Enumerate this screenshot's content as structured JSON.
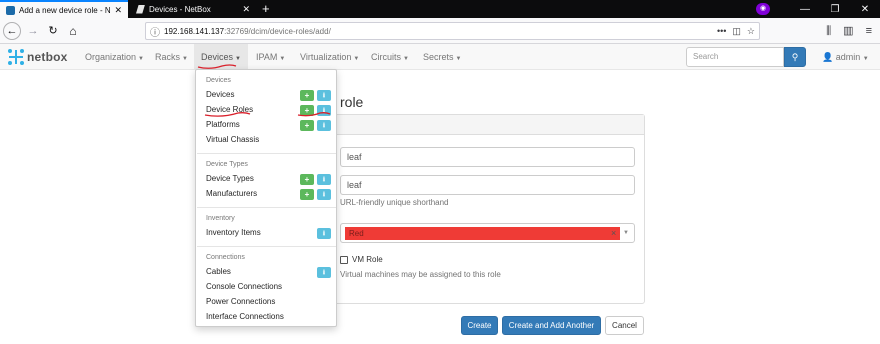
{
  "browser": {
    "tabs": [
      {
        "title": "Add a new device role - NetBo",
        "active": true
      },
      {
        "title": "Devices - NetBox",
        "active": false
      }
    ],
    "url_host": "192.168.141.137",
    "url_path": ":32769/dcim/device-roles/add/"
  },
  "netbox": {
    "brand": "netbox",
    "menus": [
      {
        "label": "Organization"
      },
      {
        "label": "Racks"
      },
      {
        "label": "Devices"
      },
      {
        "label": "IPAM"
      },
      {
        "label": "Virtualization"
      },
      {
        "label": "Circuits"
      },
      {
        "label": "Secrets"
      }
    ],
    "search_placeholder": "Search",
    "user": "admin"
  },
  "dropdown": {
    "sections": [
      {
        "header": "Devices",
        "items": [
          {
            "label": "Devices",
            "add": true,
            "import": true
          },
          {
            "label": "Device Roles",
            "add": true,
            "import": true
          },
          {
            "label": "Platforms",
            "add": true,
            "import": true
          },
          {
            "label": "Virtual Chassis",
            "add": false,
            "import": false
          }
        ]
      },
      {
        "header": "Device Types",
        "items": [
          {
            "label": "Device Types",
            "add": true,
            "import": true
          },
          {
            "label": "Manufacturers",
            "add": true,
            "import": true
          }
        ]
      },
      {
        "header": "Inventory",
        "items": [
          {
            "label": "Inventory Items",
            "add": false,
            "import": true
          }
        ]
      },
      {
        "header": "Connections",
        "items": [
          {
            "label": "Cables",
            "add": false,
            "import": true
          },
          {
            "label": "Console Connections",
            "add": false,
            "import": false
          },
          {
            "label": "Power Connections",
            "add": false,
            "import": false
          },
          {
            "label": "Interface Connections",
            "add": false,
            "import": false
          }
        ]
      }
    ]
  },
  "form": {
    "heading_visible": "role",
    "name_value": "leaf",
    "slug_value": "leaf",
    "slug_help": "URL-friendly unique shorthand",
    "color_value": "Red",
    "color_hex": "#ef3b36",
    "vm_role_label": "VM Role",
    "vm_role_checked": false,
    "vm_role_help": "Virtual machines may be assigned to this role",
    "create_label": "Create",
    "create_add_label": "Create and Add Another",
    "cancel_label": "Cancel"
  },
  "icons": {
    "add": "plus-icon",
    "import": "import-icon",
    "search": "search-icon",
    "user": "user-icon"
  }
}
